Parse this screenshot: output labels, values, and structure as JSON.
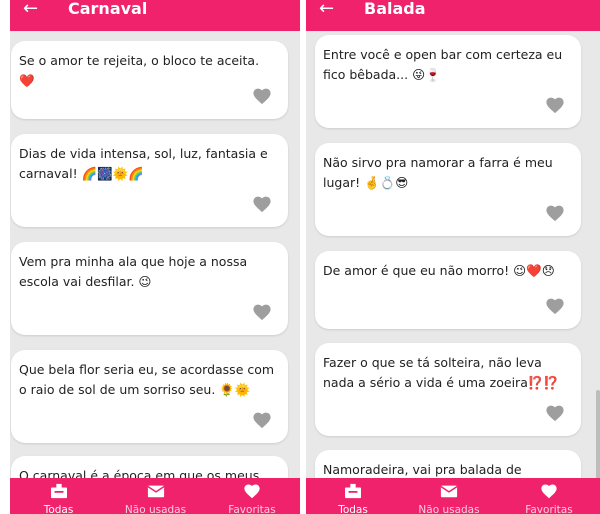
{
  "colors": {
    "accent": "#f0226c",
    "background": "#e8e8e8",
    "card": "#ffffff",
    "heart": "#9e9e9e"
  },
  "left": {
    "title": "Carnaval",
    "cards": [
      {
        "text": "Se o amor te rejeita, o bloco te aceita. ❤️"
      },
      {
        "text": "Dias de vida intensa, sol, luz, fantasia e carnaval! 🌈🎆🌞🌈"
      },
      {
        "text": "Vem pra minha ala que hoje a nossa escola vai desfilar. 😉"
      },
      {
        "text": "Que bela flor seria eu, se acordasse com o raio de sol de um sorriso seu. 🌻🌞"
      },
      {
        "text": "O carnaval é a época em que os meus"
      }
    ],
    "nav": {
      "items": [
        {
          "label": "Todas"
        },
        {
          "label": "Não usadas"
        },
        {
          "label": "Favoritas"
        }
      ]
    }
  },
  "right": {
    "title": "Balada",
    "cards": [
      {
        "text": "Entre você e open bar com certeza eu fico bêbada... 😜🍷"
      },
      {
        "text": "Não sirvo pra namorar a farra é meu lugar! 🤞💍😎"
      },
      {
        "text": "De amor é que eu não morro! 😉❤️😞"
      },
      {
        "text": "Fazer o que se tá solteira, não leva nada a sério a vida é uma zoeira⁉️⁉️"
      },
      {
        "text": "Namoradeira, vai pra balada de segunda a"
      }
    ],
    "nav": {
      "items": [
        {
          "label": "Todas"
        },
        {
          "label": "Não usadas"
        },
        {
          "label": "Favoritas"
        }
      ]
    }
  },
  "icons": {
    "back": "arrow-left-icon",
    "heart": "heart-icon",
    "all": "inbox-icon",
    "unused": "envelope-icon",
    "favorites": "heart-icon"
  }
}
